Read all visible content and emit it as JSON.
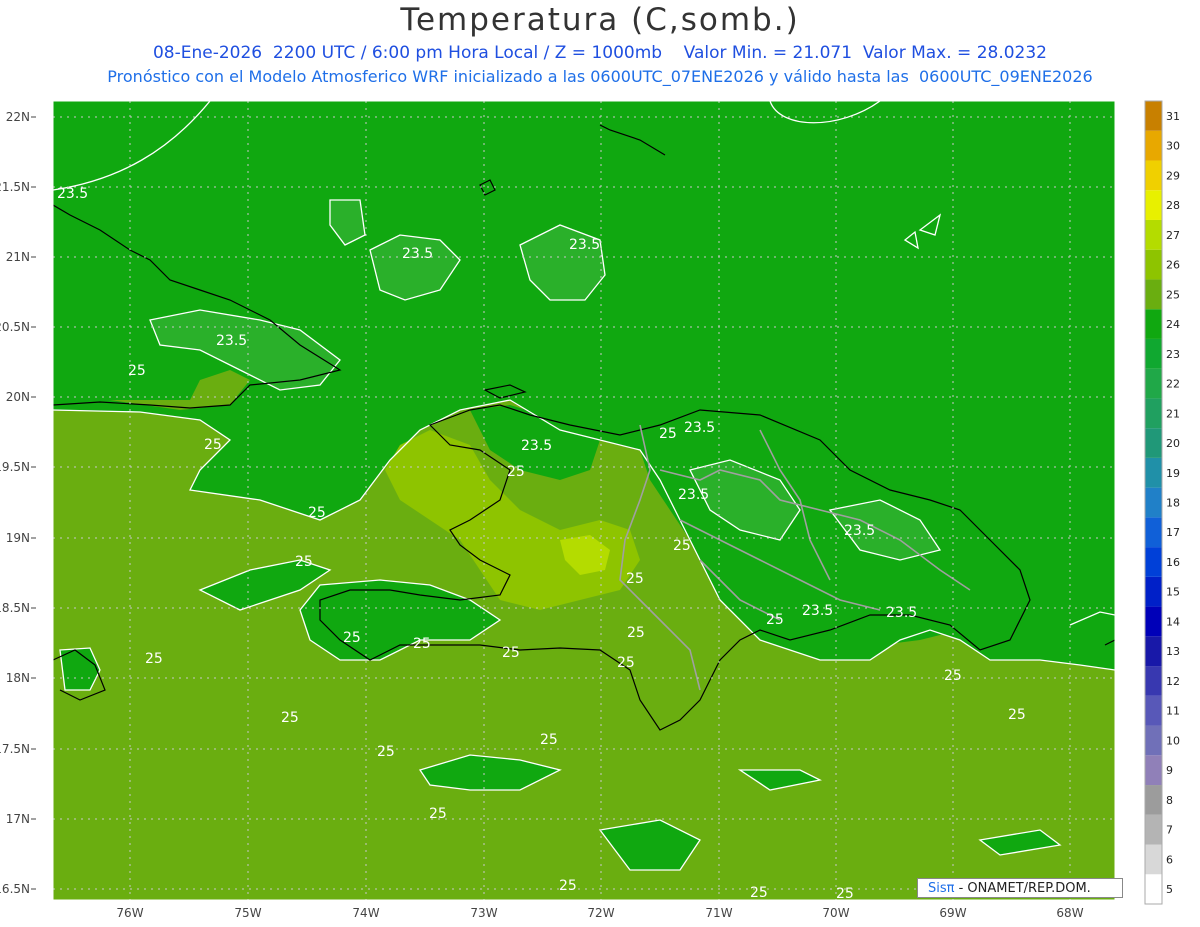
{
  "header": {
    "title": "Temperatura (C,somb.)",
    "line2": "08-Ene-2026  2200 UTC / 6:00 pm Hora Local / Z = 1000mb    Valor Min. = 21.071  Valor Max. = 28.0232",
    "line3": "Pronóstico con el Modelo Atmosferico WRF inicializado a las 0600UTC_07ENE2026 y válido hasta las  0600UTC_09ENE2026"
  },
  "map": {
    "lat_labels": [
      "22N",
      "21.5N",
      "21N",
      "20.5N",
      "20N",
      "19.5N",
      "19N",
      "18.5N",
      "18N",
      "17.5N",
      "17N",
      "16.5N"
    ],
    "lon_labels": [
      "76W",
      "75W",
      "74W",
      "73W",
      "72W",
      "71W",
      "70W",
      "69W",
      "68W"
    ],
    "contour_labels": [
      "23.5",
      "25"
    ],
    "colors": {
      "field_24": "#10a810",
      "field_25": "#6aae10",
      "field_23": "#2ab02a",
      "field_26": "#8ec400",
      "field_27": "#b4dc00",
      "contour": "#ffffff",
      "coast": "#000000",
      "border": "#a0a0a0"
    }
  },
  "colorbar": {
    "levels": [
      "5",
      "6",
      "7",
      "8",
      "9",
      "10",
      "11",
      "12",
      "13",
      "14",
      "15",
      "16",
      "17",
      "18",
      "19",
      "20",
      "21",
      "22",
      "23",
      "24",
      "25",
      "26",
      "27",
      "28",
      "29",
      "30",
      "31"
    ],
    "colors": [
      "#ffffff",
      "#d8d8d8",
      "#b4b4b4",
      "#9c9c9c",
      "#9080b8",
      "#7070b8",
      "#5858b8",
      "#3838b0",
      "#1818a8",
      "#0000b8",
      "#0020c8",
      "#0040d8",
      "#1060d8",
      "#2080c8",
      "#2090a8",
      "#209878",
      "#20a060",
      "#20a848",
      "#10a830",
      "#10a810",
      "#6aae10",
      "#8ec400",
      "#b4dc00",
      "#e8f000",
      "#f0d000",
      "#e8a800",
      "#c88000"
    ]
  },
  "credit": {
    "sis": "Sisπ",
    "text": " - ONAMET/REP.DOM."
  }
}
